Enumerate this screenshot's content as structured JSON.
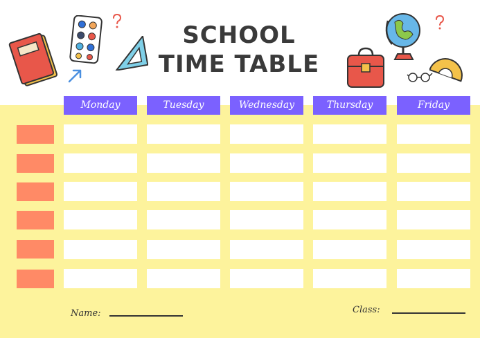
{
  "header": {
    "title_line1": "SCHOOL",
    "title_line2": "TIME TABLE"
  },
  "days": [
    "Monday",
    "Tuesday",
    "Wednesday",
    "Thursday",
    "Friday"
  ],
  "footer": {
    "name_label": "Name:",
    "class_label": "Class:"
  },
  "colors": {
    "day_header": "#7b61ff",
    "row_label": "#ff8a66",
    "background_yellow": "#fdf39c",
    "cell": "#ffffff"
  },
  "icons": [
    "book-icon",
    "paint-palette-icon",
    "ruler-triangle-icon",
    "question-mark-icon",
    "arrow-icon",
    "globe-icon",
    "school-bag-icon",
    "protractor-icon",
    "glasses-icon"
  ]
}
